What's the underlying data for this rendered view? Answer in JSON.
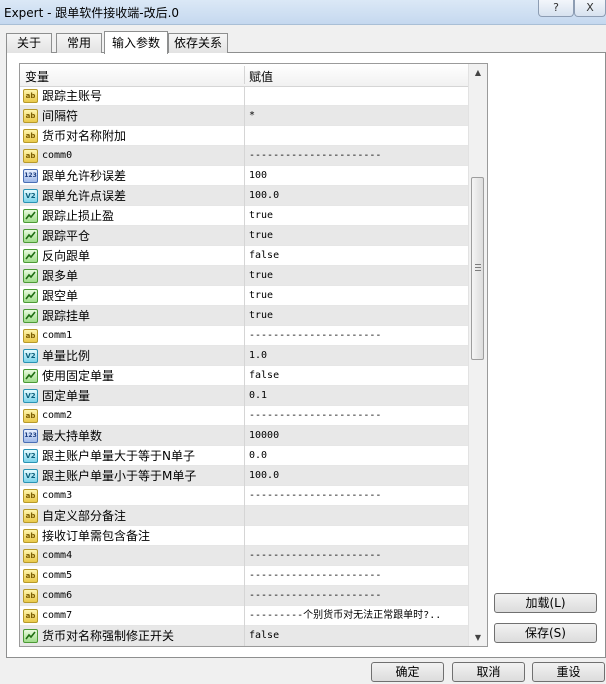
{
  "window": {
    "title": "Expert - 跟单软件接收端-改后.0",
    "help_button": "?",
    "close_button": "X"
  },
  "tabs": [
    {
      "label": "关于",
      "active": false
    },
    {
      "label": "常用",
      "active": false
    },
    {
      "label": "输入参数",
      "active": true
    },
    {
      "label": "依存关系",
      "active": false
    }
  ],
  "grid": {
    "col_variable": "变量",
    "col_value": "赋值",
    "rows": [
      {
        "type": "ab",
        "name": "跟踪主账号",
        "value": "",
        "mono": false
      },
      {
        "type": "ab",
        "name": "间隔符",
        "value": "*",
        "mono": false
      },
      {
        "type": "ab",
        "name": "货币对名称附加",
        "value": "",
        "mono": false
      },
      {
        "type": "ab",
        "name": "comm0",
        "value": "----------------------",
        "mono": true
      },
      {
        "type": "123",
        "name": "跟单允许秒误差",
        "value": "100",
        "mono": false
      },
      {
        "type": "v2",
        "name": "跟单允许点误差",
        "value": "100.0",
        "mono": false
      },
      {
        "type": "bool",
        "name": "跟踪止损止盈",
        "value": "true",
        "mono": false
      },
      {
        "type": "bool",
        "name": "跟踪平仓",
        "value": "true",
        "mono": false
      },
      {
        "type": "bool",
        "name": "反向跟单",
        "value": "false",
        "mono": false
      },
      {
        "type": "bool",
        "name": "跟多单",
        "value": "true",
        "mono": false
      },
      {
        "type": "bool",
        "name": "跟空单",
        "value": "true",
        "mono": false
      },
      {
        "type": "bool",
        "name": "跟踪挂单",
        "value": "true",
        "mono": false
      },
      {
        "type": "ab",
        "name": "comm1",
        "value": "----------------------",
        "mono": true
      },
      {
        "type": "v2",
        "name": "单量比例",
        "value": "1.0",
        "mono": false
      },
      {
        "type": "bool",
        "name": "使用固定单量",
        "value": "false",
        "mono": false
      },
      {
        "type": "v2",
        "name": "固定单量",
        "value": "0.1",
        "mono": false
      },
      {
        "type": "ab",
        "name": "comm2",
        "value": "----------------------",
        "mono": true
      },
      {
        "type": "123",
        "name": "最大持单数",
        "value": "10000",
        "mono": false
      },
      {
        "type": "v2",
        "name": "跟主账户单量大于等于N单子",
        "value": "0.0",
        "mono": false
      },
      {
        "type": "v2",
        "name": "跟主账户单量小于等于M单子",
        "value": "100.0",
        "mono": false
      },
      {
        "type": "ab",
        "name": "comm3",
        "value": "----------------------",
        "mono": true
      },
      {
        "type": "ab",
        "name": "自定义部分备注",
        "value": "",
        "mono": false
      },
      {
        "type": "ab",
        "name": "接收订单需包含备注",
        "value": "",
        "mono": false
      },
      {
        "type": "ab",
        "name": "comm4",
        "value": "----------------------",
        "mono": true
      },
      {
        "type": "ab",
        "name": "comm5",
        "value": "----------------------",
        "mono": true
      },
      {
        "type": "ab",
        "name": "comm6",
        "value": "----------------------",
        "mono": true
      },
      {
        "type": "ab",
        "name": "comm7",
        "value": "---------个别货币对无法正常跟单时?..",
        "mono": true
      },
      {
        "type": "bool",
        "name": "货币对名称强制修正开关",
        "value": "false",
        "mono": false
      }
    ]
  },
  "buttons": {
    "load": "加载(L)",
    "save": "保存(S)",
    "ok": "确定",
    "cancel": "取消",
    "reset": "重设"
  }
}
